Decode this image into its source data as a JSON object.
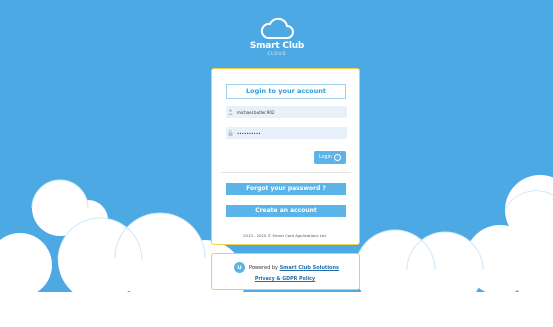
{
  "brand": {
    "name": "Smart Club",
    "sub": "CLOUD"
  },
  "login": {
    "title": "Login to your account",
    "username_value": "michael.butler.902",
    "password_value": "••••••••••",
    "login_label": "Login",
    "forgot_label": "Forgot your password ?",
    "create_label": "Create an account",
    "copyright": "2013 - 2020 © Smart Card Applications Ltd."
  },
  "powered": {
    "prefix": "Powered by",
    "link": "Smart Club Solutions",
    "privacy": "Privacy & GDPR Policy"
  },
  "colors": {
    "background": "#4da9e3",
    "accent": "#5bb4e7",
    "card_border": "#f2d04a",
    "link": "#1f6fae"
  },
  "icons": {
    "brand": "cloud-icon",
    "user": "user-icon",
    "password": "lock-icon",
    "login": "arrow-right-circle-icon",
    "powered": "smart-club-logo-icon"
  }
}
